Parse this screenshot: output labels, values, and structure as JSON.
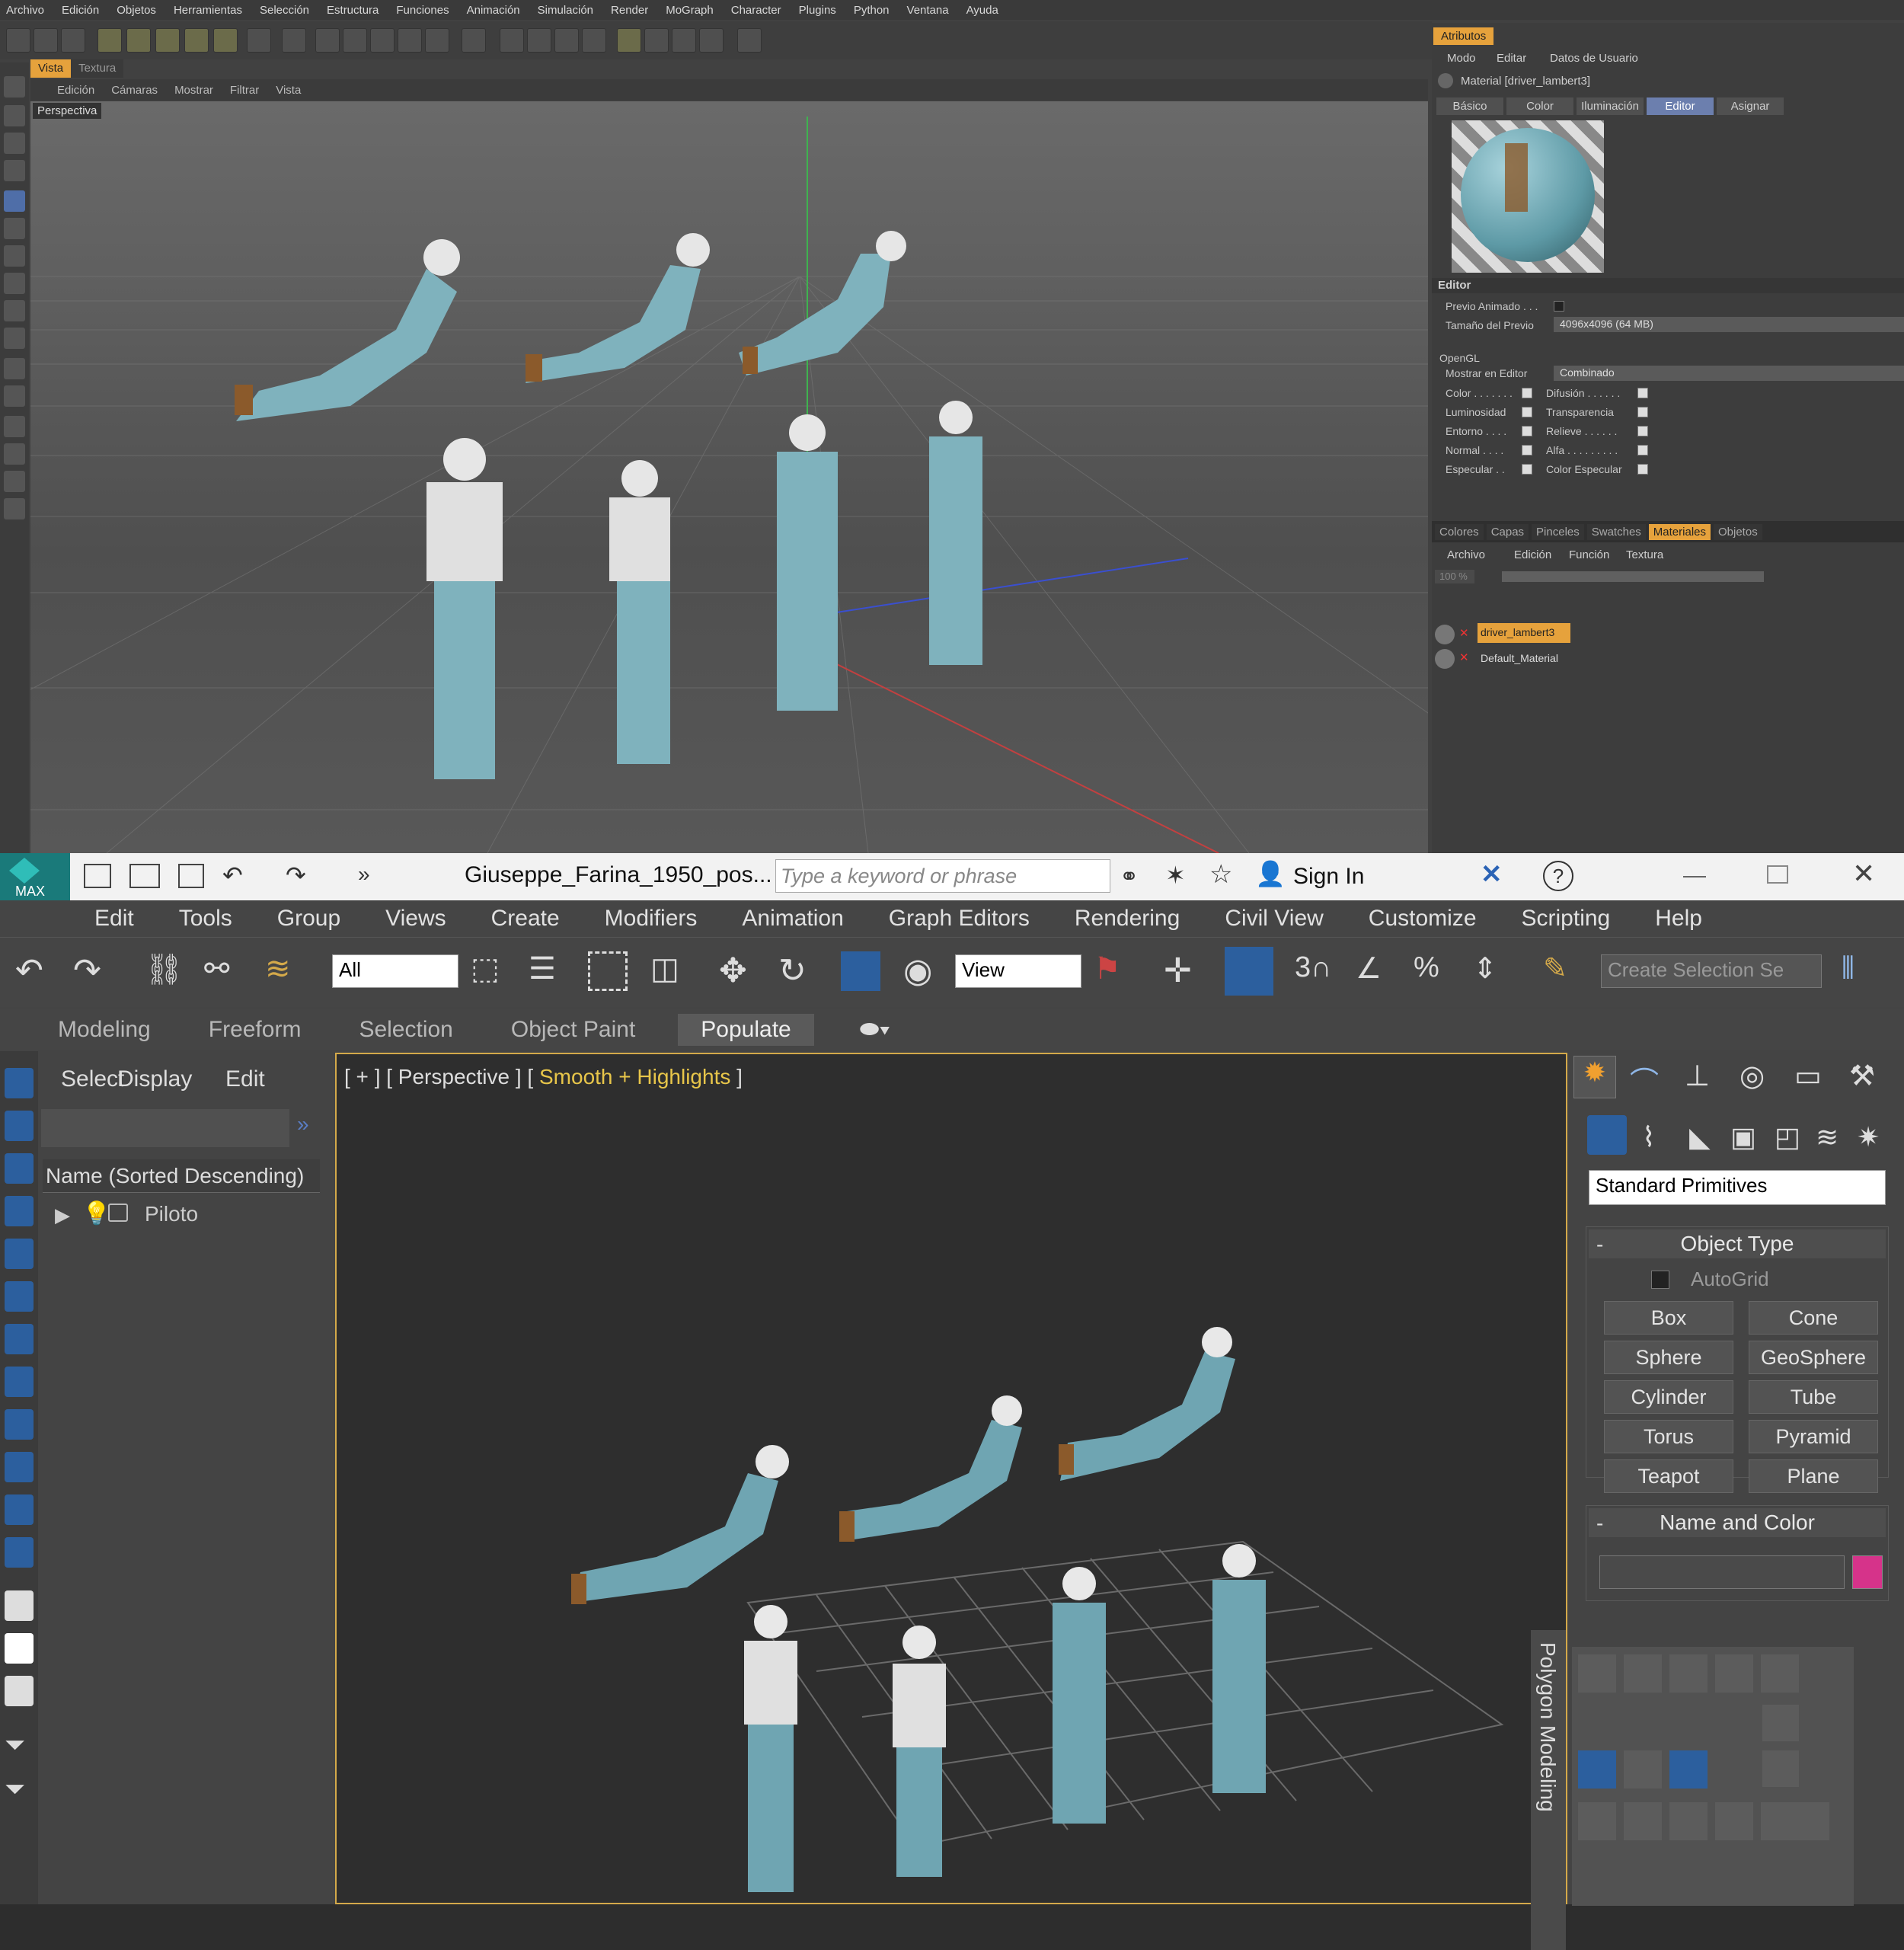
{
  "c4d": {
    "menu": [
      "Archivo",
      "Edición",
      "Objetos",
      "Herramientas",
      "Selección",
      "Estructura",
      "Funciones",
      "Animación",
      "Simulación",
      "Render",
      "MoGraph",
      "Character",
      "Plugins",
      "Python",
      "Ventana",
      "Ayuda"
    ],
    "view_tabs": {
      "vista": "Vista",
      "textura": "Textura"
    },
    "view_menu": [
      "Edición",
      "Cámaras",
      "Mostrar",
      "Filtrar",
      "Vista"
    ],
    "viewport_label": "Perspectiva",
    "attributes": {
      "tab": "Atributos",
      "menu": [
        "Modo",
        "Editar",
        "Datos de Usuario"
      ],
      "material_title": "Material [driver_lambert3]",
      "subtabs": [
        "Básico",
        "Color",
        "Iluminación",
        "Editor",
        "Asignar"
      ],
      "active_subtab": "Editor",
      "section": "Editor",
      "previo_animado": "Previo Animado . . .",
      "tamano_previo_label": "Tamaño del Previo",
      "tamano_previo_value": "4096x4096 (64 MB)",
      "opengl": "OpenGL",
      "mostrar_label": "Mostrar en Editor",
      "mostrar_value": "Combinado",
      "channels_left": [
        "Color . . . . . . .",
        "Luminosidad",
        "Entorno . . . .",
        "Normal . . . .",
        "Especular . ."
      ],
      "channels_right": [
        "Difusión . . . . . .",
        "Transparencia",
        "Relieve . . . . . .",
        "Alfa . . . . . . . . .",
        "Color Especular"
      ]
    },
    "materials_panel": {
      "tabs": [
        "Colores",
        "Capas",
        "Pinceles",
        "Swatches",
        "Materiales",
        "Objetos"
      ],
      "active_tab": "Materiales",
      "menu": [
        "Archivo",
        "Edición",
        "Función",
        "Textura"
      ],
      "zoom": "100 %",
      "items": [
        "driver_lambert3",
        "Default_Material"
      ]
    }
  },
  "max": {
    "logo": "MAX",
    "file_title": "Giuseppe_Farina_1950_pos...",
    "search_placeholder": "Type a keyword or phrase",
    "sign_in": "Sign In",
    "menu": [
      "Edit",
      "Tools",
      "Group",
      "Views",
      "Create",
      "Modifiers",
      "Animation",
      "Graph Editors",
      "Rendering",
      "Civil View",
      "Customize",
      "Scripting",
      "Help"
    ],
    "selection_filter": "All",
    "ref_coord": "View",
    "selection_set_placeholder": "Create Selection Se",
    "ribbon_tabs": [
      "Modeling",
      "Freeform",
      "Selection",
      "Object Paint",
      "Populate"
    ],
    "active_ribbon_tab": "Populate",
    "explorer": {
      "menu": [
        "Select",
        "Display",
        "Edit"
      ],
      "column_header": "Name (Sorted Descending)",
      "item": "Piloto"
    },
    "viewport_label_a": "[ + ] [ Perspective ] [ ",
    "viewport_label_b": "Smooth + Highlights",
    "viewport_label_c": " ]",
    "command_panel": {
      "category": "Standard Primitives",
      "object_type_title": "Object Type",
      "autogrid": "AutoGrid",
      "buttons": [
        "Box",
        "Cone",
        "Sphere",
        "GeoSphere",
        "Cylinder",
        "Tube",
        "Torus",
        "Pyramid",
        "Teapot",
        "Plane"
      ],
      "name_color_title": "Name and Color",
      "color": "#d6338a"
    },
    "polygon_modeling": "Polygon Modeling"
  },
  "colors": {
    "accent_c4d": "#e6a23c",
    "accent_max": "#d4a94a",
    "suit": "#7fb2bd",
    "glove": "#8b5a2b"
  }
}
